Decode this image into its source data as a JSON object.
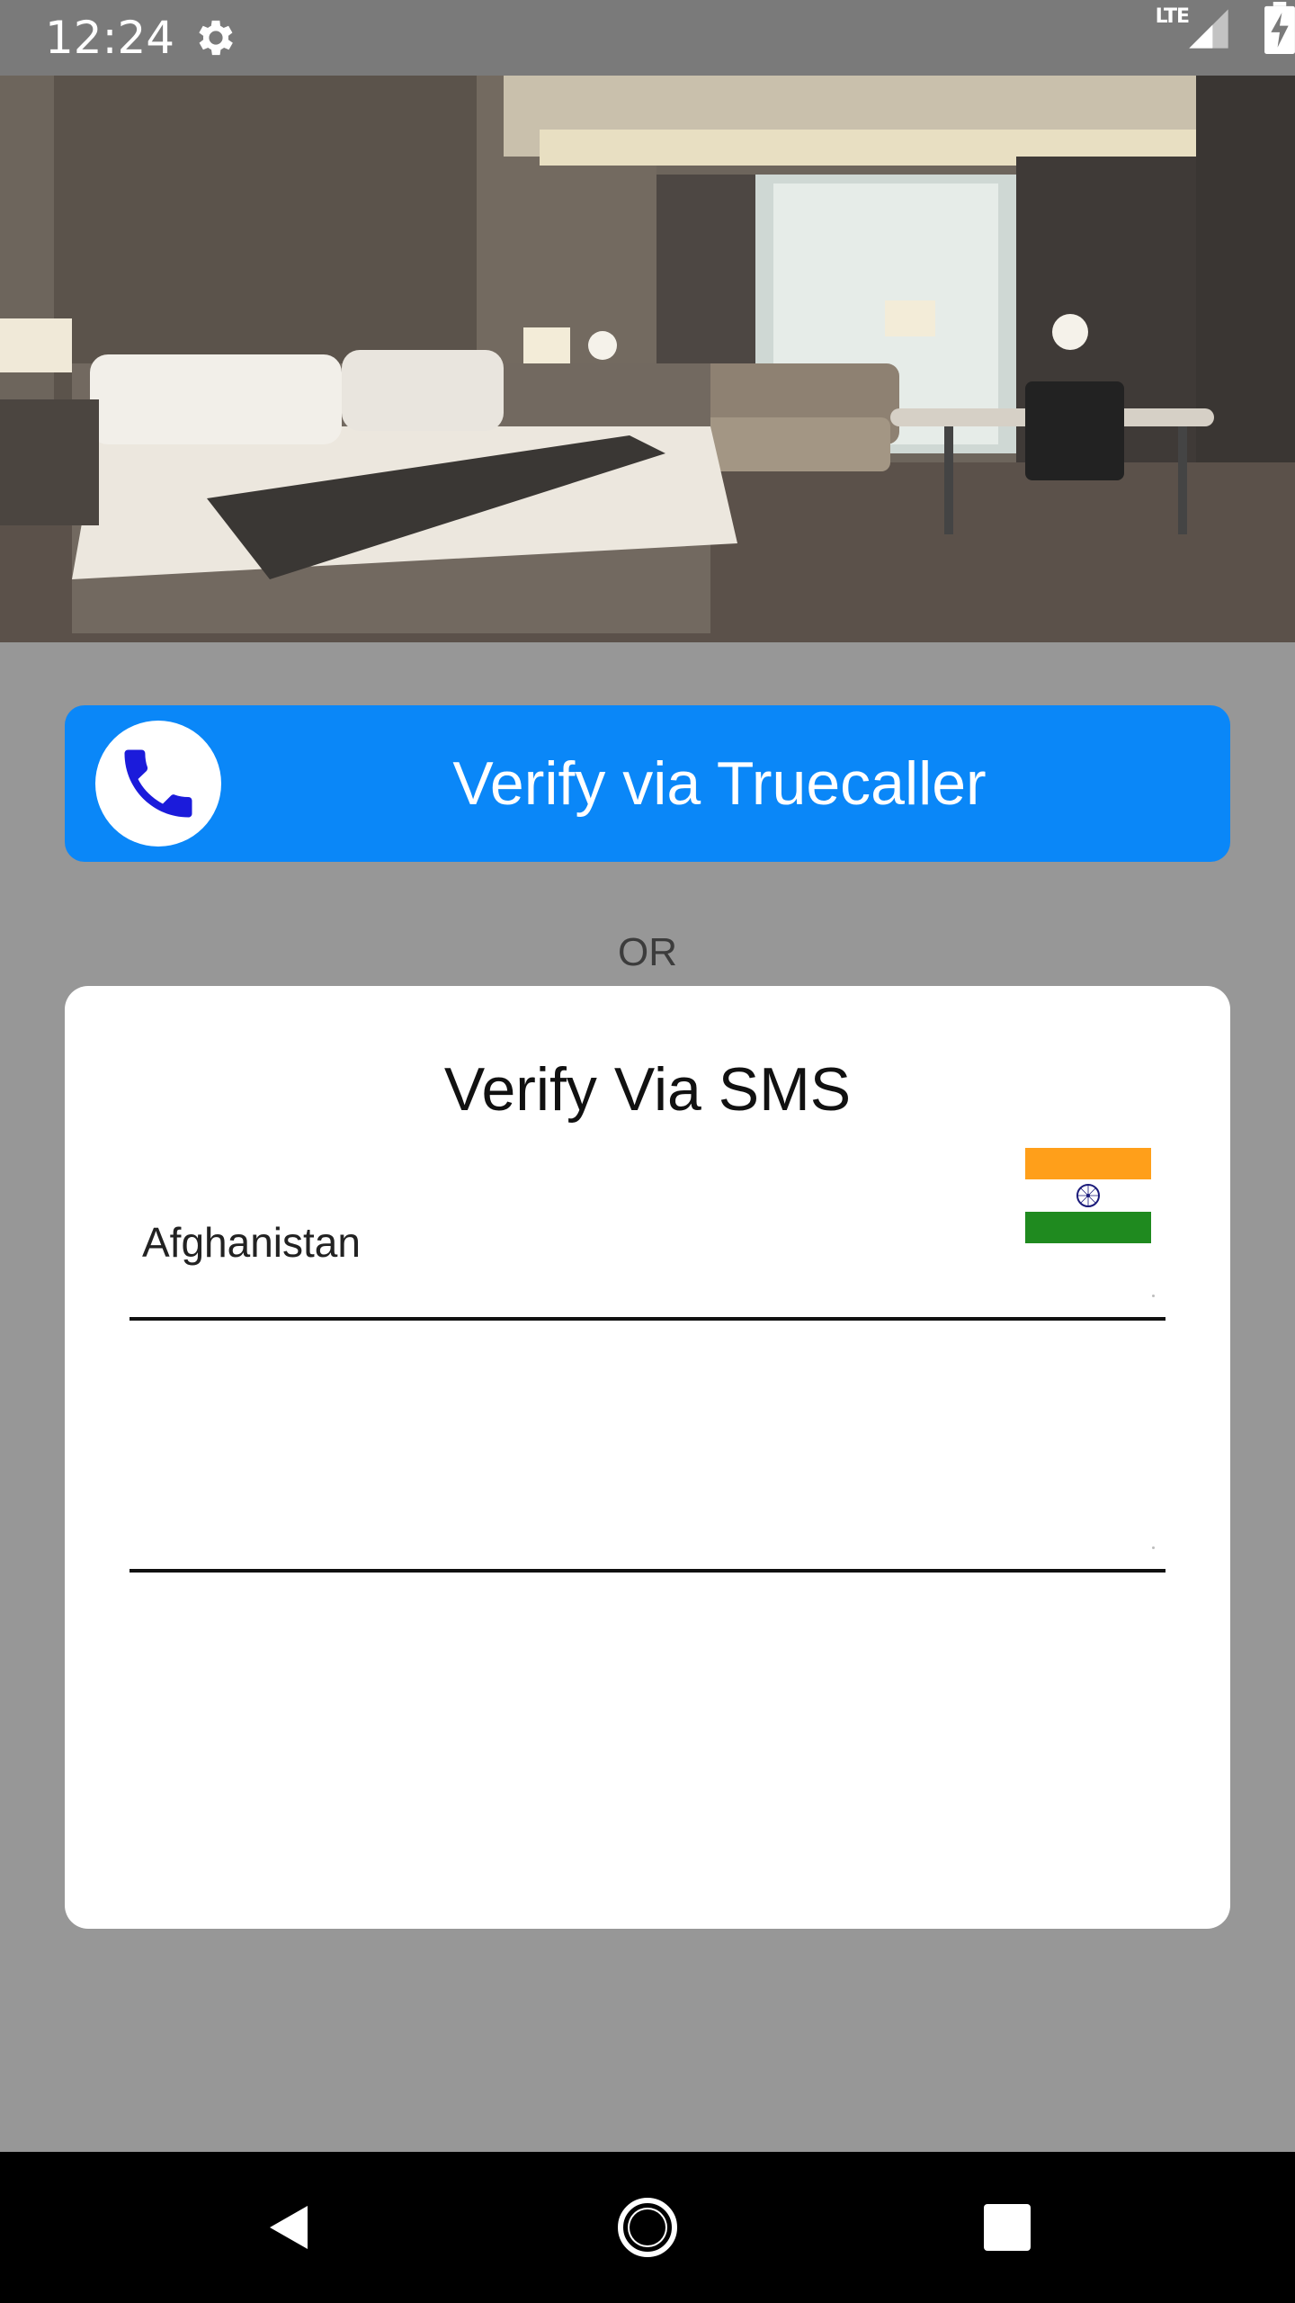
{
  "status_bar": {
    "time": "12:24",
    "network": "LTE",
    "icons": [
      "gear-icon",
      "signal-icon",
      "battery-charging-icon"
    ]
  },
  "hero": {
    "icon": "hotel-room-photo"
  },
  "truecaller": {
    "label": "Verify via Truecaller",
    "icon": "phone-icon",
    "color": "#0a87f8"
  },
  "divider": {
    "or_text": "OR"
  },
  "sms": {
    "title": "Verify Via SMS",
    "country_value": "Afghanistan",
    "flag_icon": "india-flag-icon",
    "phone_value": "",
    "phone_placeholder": ""
  },
  "nav": {
    "icons": [
      "back-icon",
      "home-icon",
      "recents-icon"
    ]
  }
}
